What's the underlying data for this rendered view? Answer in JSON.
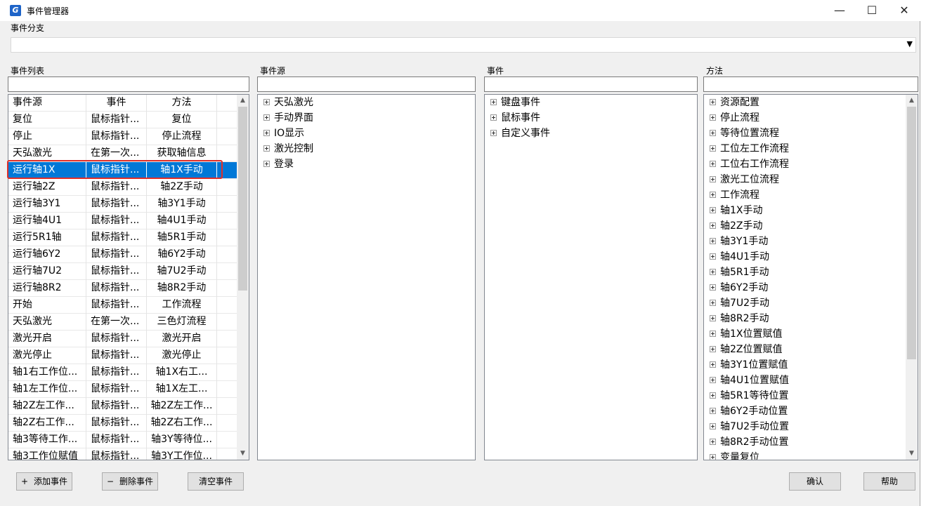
{
  "window": {
    "title": "事件管理器",
    "icon_letter": "G"
  },
  "window_controls": {
    "minimize": "—",
    "maximize": "☐",
    "close": "✕"
  },
  "branch": {
    "label": "事件分支",
    "value": ""
  },
  "event_list": {
    "label": "事件列表",
    "headers": [
      "事件源",
      "事件",
      "方法"
    ],
    "rows": [
      [
        "复位",
        "鼠标指针...",
        "复位"
      ],
      [
        "停止",
        "鼠标指针...",
        "停止流程"
      ],
      [
        "天弘激光",
        "在第一次...",
        "获取轴信息"
      ],
      [
        "运行轴1X",
        "鼠标指针...",
        "轴1X手动"
      ],
      [
        "运行轴2Z",
        "鼠标指针...",
        "轴2Z手动"
      ],
      [
        "运行轴3Y1",
        "鼠标指针...",
        "轴3Y1手动"
      ],
      [
        "运行轴4U1",
        "鼠标指针...",
        "轴4U1手动"
      ],
      [
        "运行5R1轴",
        "鼠标指针...",
        "轴5R1手动"
      ],
      [
        "运行轴6Y2",
        "鼠标指针...",
        "轴6Y2手动"
      ],
      [
        "运行轴7U2",
        "鼠标指针...",
        "轴7U2手动"
      ],
      [
        "运行轴8R2",
        "鼠标指针...",
        "轴8R2手动"
      ],
      [
        "开始",
        "鼠标指针...",
        "工作流程"
      ],
      [
        "天弘激光",
        "在第一次...",
        "三色灯流程"
      ],
      [
        "激光开启",
        "鼠标指针...",
        "激光开启"
      ],
      [
        "激光停止",
        "鼠标指针...",
        "激光停止"
      ],
      [
        "轴1右工作位...",
        "鼠标指针...",
        "轴1X右工..."
      ],
      [
        "轴1左工作位...",
        "鼠标指针...",
        "轴1X左工..."
      ],
      [
        "轴2Z左工作...",
        "鼠标指针...",
        "轴2Z左工作..."
      ],
      [
        "轴2Z右工作...",
        "鼠标指针...",
        "轴2Z右工作..."
      ],
      [
        "轴3等待工作...",
        "鼠标指针...",
        "轴3Y等待位..."
      ],
      [
        "轴3工作位赋值",
        "鼠标指针...",
        "轴3Y工作位..."
      ]
    ],
    "selected_index": 3
  },
  "event_source": {
    "label": "事件源",
    "items": [
      "天弘激光",
      "手动界面",
      "IO显示",
      "激光控制",
      "登录"
    ]
  },
  "events": {
    "label": "事件",
    "items": [
      "键盘事件",
      "鼠标事件",
      "自定义事件"
    ]
  },
  "methods": {
    "label": "方法",
    "items": [
      "资源配置",
      "停止流程",
      "等待位置流程",
      "工位左工作流程",
      "工位右工作流程",
      "激光工位流程",
      "工作流程",
      "轴1X手动",
      "轴2Z手动",
      "轴3Y1手动",
      "轴4U1手动",
      "轴5R1手动",
      "轴6Y2手动",
      "轴7U2手动",
      "轴8R2手动",
      "轴1X位置赋值",
      "轴2Z位置赋值",
      "轴3Y1位置赋值",
      "轴4U1位置赋值",
      "轴5R1等待位置",
      "轴6Y2手动位置",
      "轴7U2手动位置",
      "轴8R2手动位置",
      "变量复位"
    ]
  },
  "buttons": {
    "add": "添加事件",
    "add_icon": "+",
    "delete": "删除事件",
    "delete_icon": "−",
    "clear": "清空事件",
    "confirm": "确认",
    "help": "帮助"
  }
}
